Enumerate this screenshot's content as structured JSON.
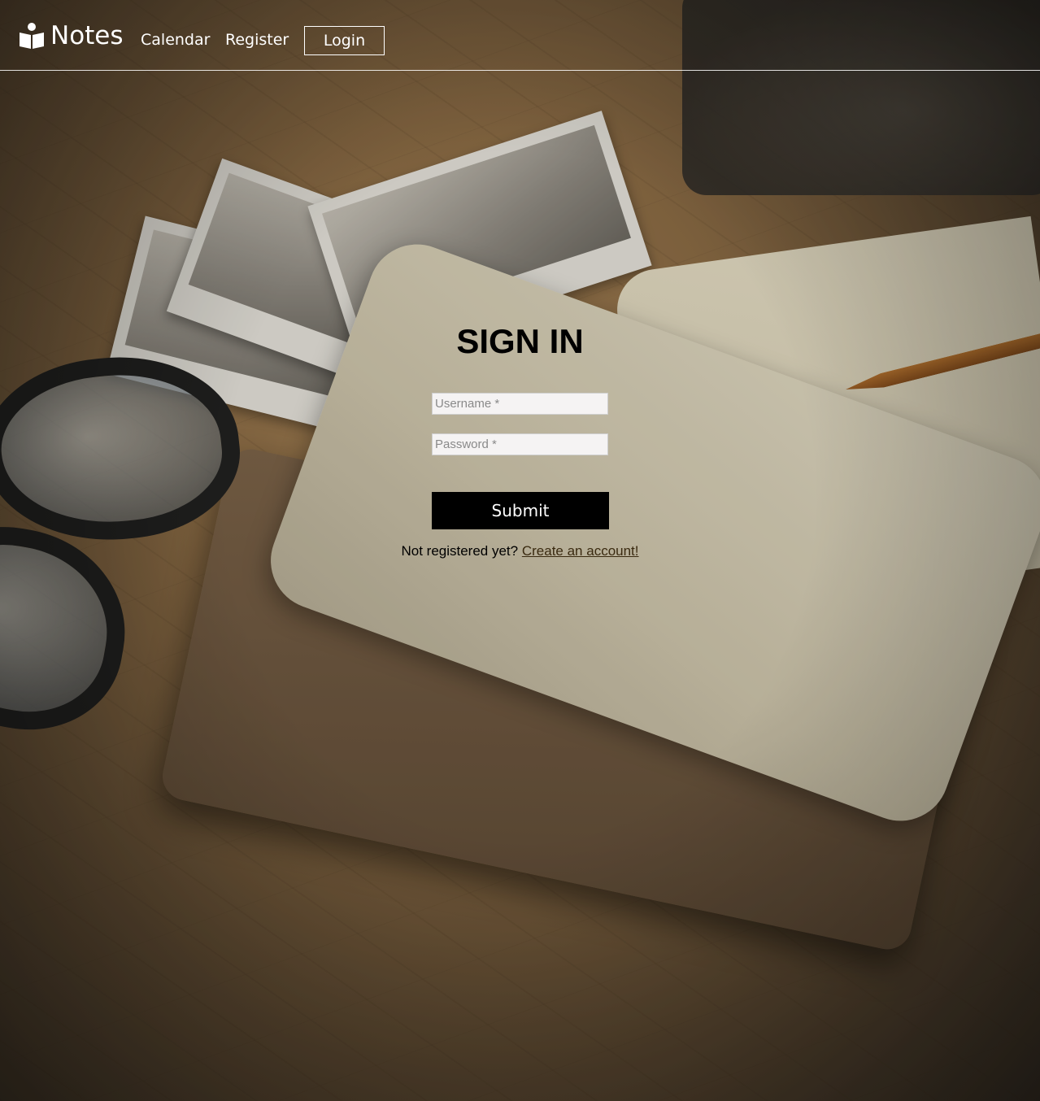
{
  "header": {
    "brand": "Notes",
    "nav": {
      "calendar": "Calendar",
      "register": "Register",
      "login": "Login"
    }
  },
  "signin": {
    "title": "SIGN IN",
    "username_placeholder": "Username *",
    "password_placeholder": "Password *",
    "submit_label": "Submit",
    "register_prompt": "Not registered yet?",
    "register_link": "Create an account!"
  },
  "icons": {
    "brand_icon": "reading-person-icon"
  },
  "colors": {
    "text_primary": "#000000",
    "header_text": "#ffffff",
    "submit_bg": "#000000",
    "submit_text": "#ffffff",
    "link": "#3a2a10",
    "input_bg": "#f5f3f3"
  }
}
